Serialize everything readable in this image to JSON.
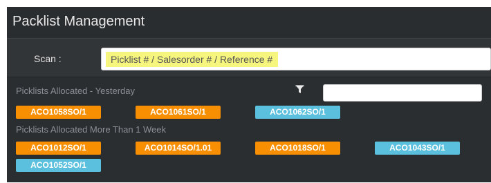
{
  "header": {
    "title": "Packlist Management"
  },
  "scan": {
    "label": "Scan :",
    "placeholder": "Picklist # / Salesorder # / Reference #"
  },
  "filter": {
    "icon": "filter-icon",
    "value": ""
  },
  "colors": {
    "orange": "#f88f02",
    "blue": "#5bc0de",
    "highlight": "#f6f67e"
  },
  "sections": [
    {
      "heading": "Picklists Allocated - Yesterday",
      "picklists": [
        {
          "label": "ACO1058SO/1",
          "color": "orange"
        },
        {
          "label": "ACO1061SO/1",
          "color": "orange"
        },
        {
          "label": "ACO1062SO/1",
          "color": "blue"
        }
      ]
    },
    {
      "heading": "Picklists Allocated More Than 1 Week",
      "picklists": [
        {
          "label": "ACO1012SO/1",
          "color": "orange"
        },
        {
          "label": "ACO1014SO/1.01",
          "color": "orange"
        },
        {
          "label": "ACO1018SO/1",
          "color": "orange"
        },
        {
          "label": "ACO1043SO/1",
          "color": "blue"
        },
        {
          "label": "ACO1052SO/1",
          "color": "blue"
        }
      ]
    }
  ]
}
